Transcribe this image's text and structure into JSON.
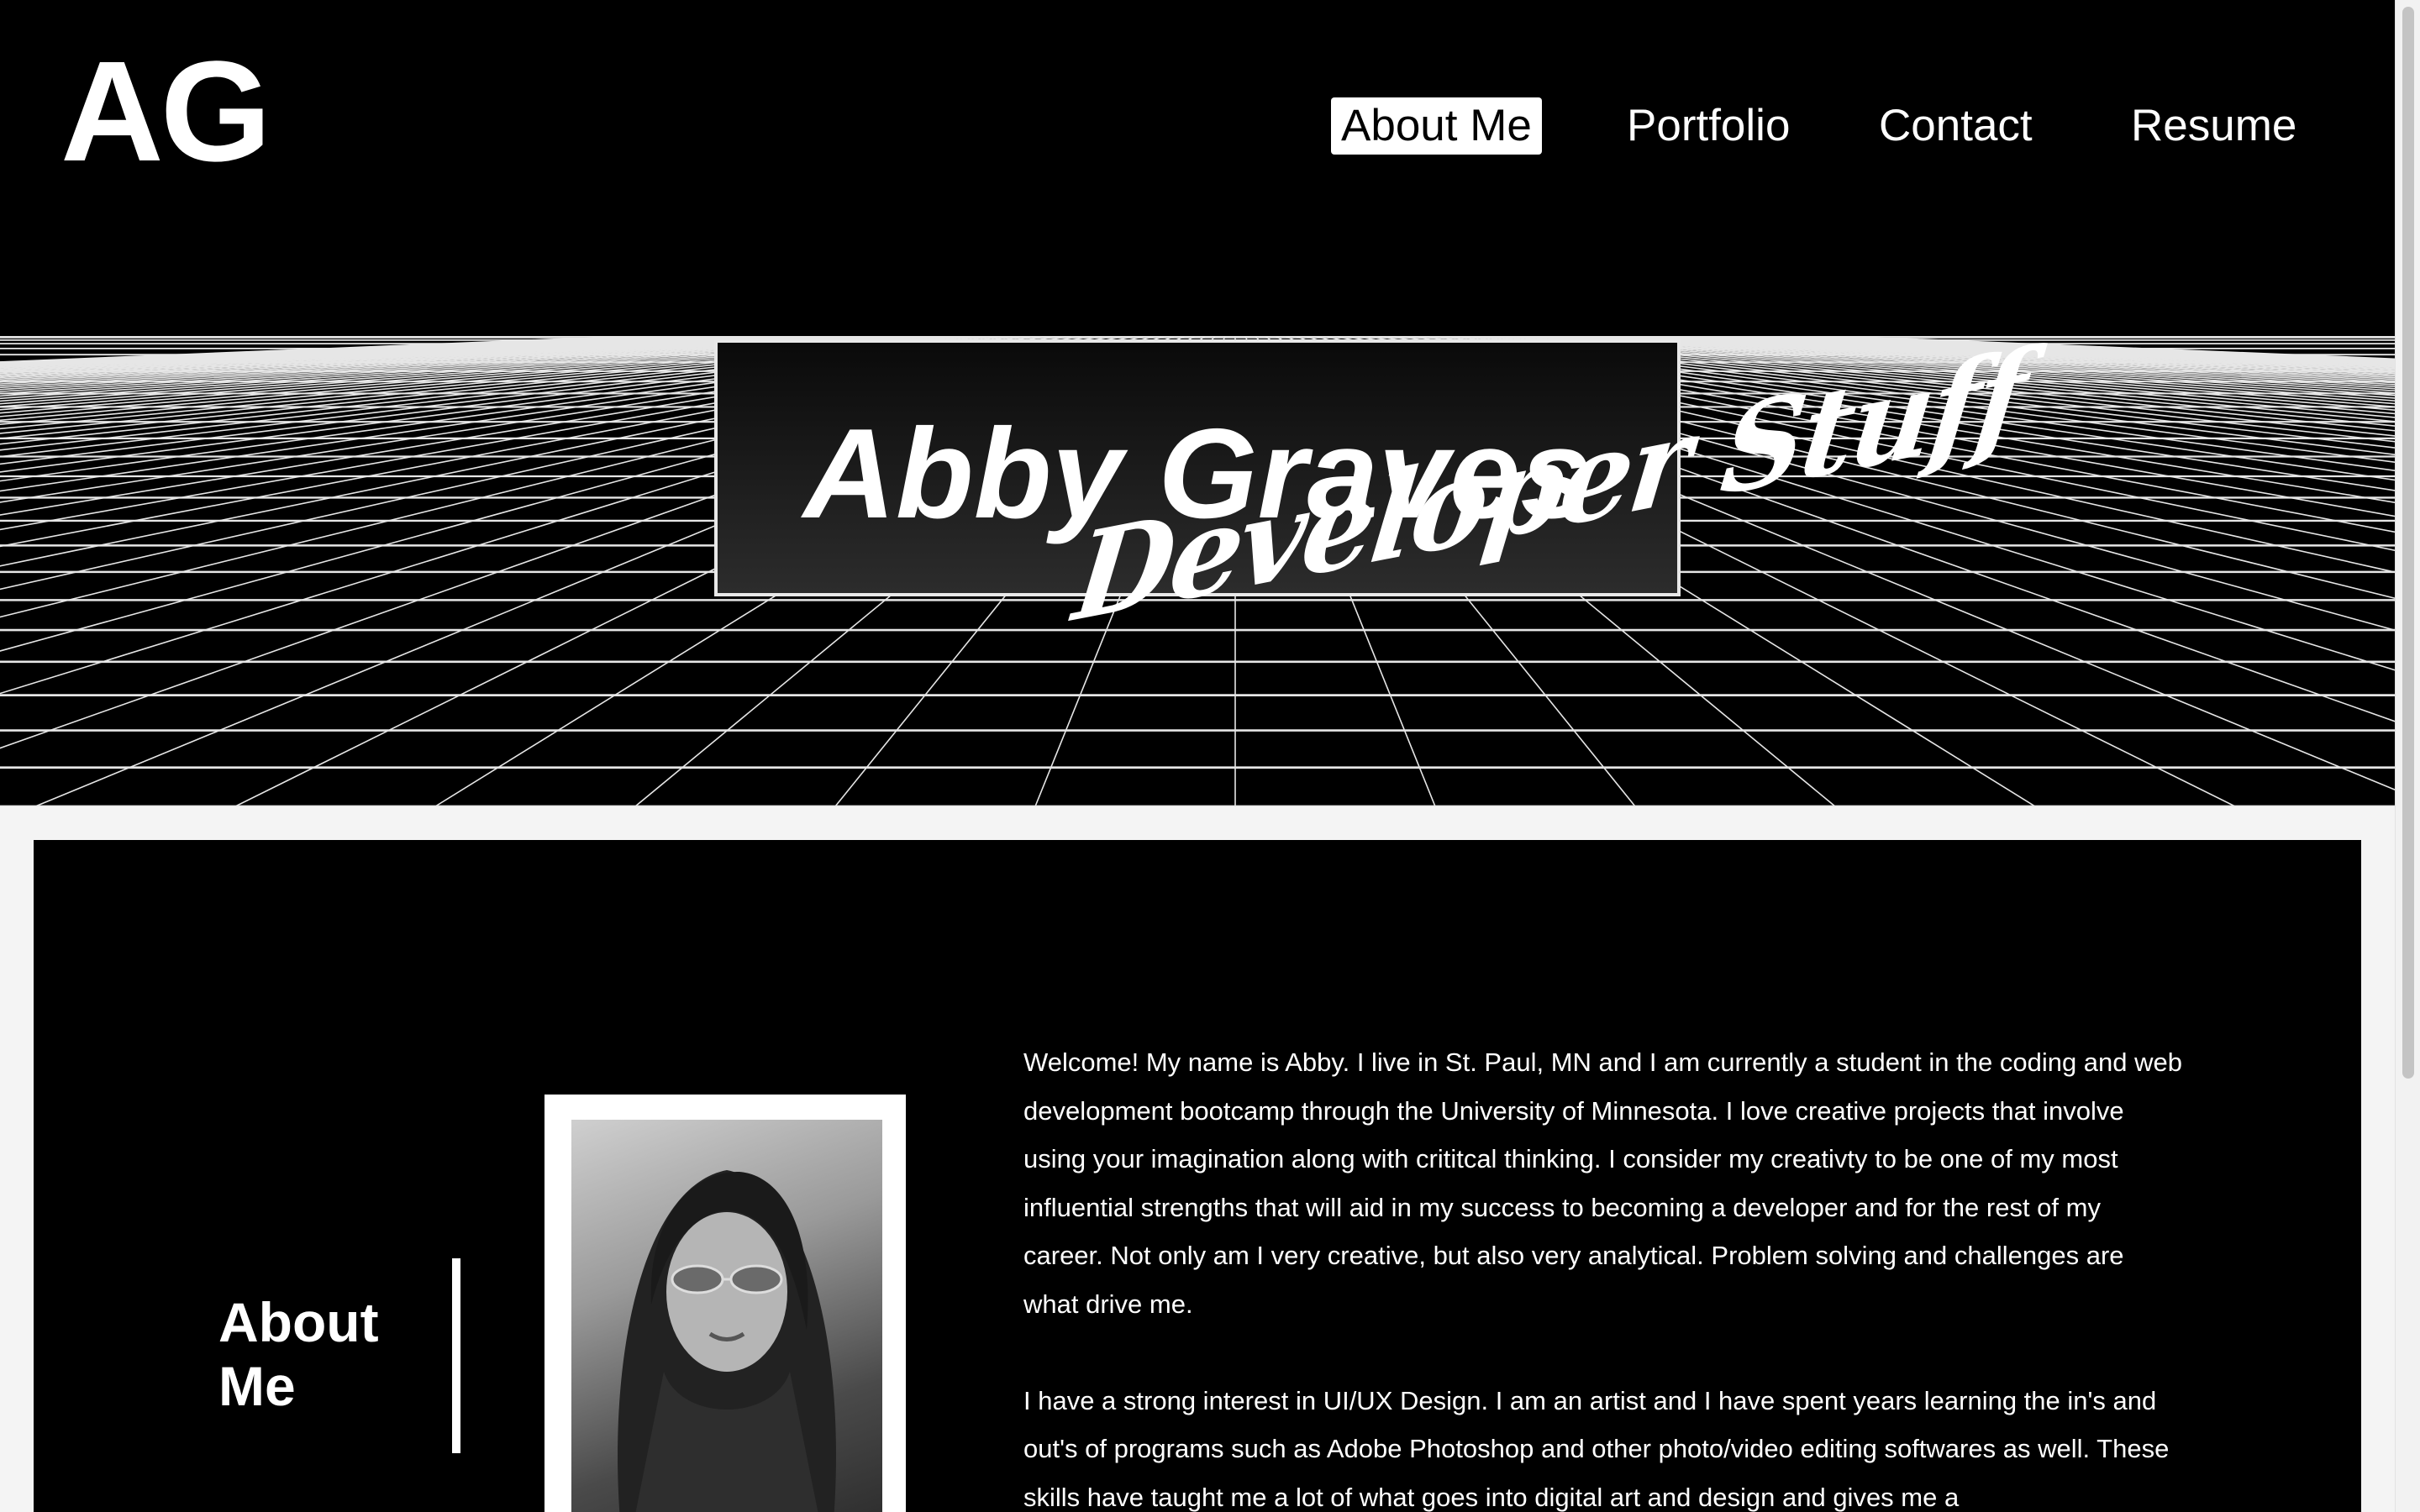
{
  "header": {
    "logo": "AG",
    "nav": [
      {
        "label": "About Me",
        "active": true
      },
      {
        "label": "Portfolio",
        "active": false
      },
      {
        "label": "Contact",
        "active": false
      },
      {
        "label": "Resume",
        "active": false
      }
    ]
  },
  "hero": {
    "name": "Abby Graves",
    "tagline": "Developer Stuff"
  },
  "about": {
    "heading": "About Me",
    "photo_icon": "portrait-photo",
    "paragraphs": [
      "Welcome! My name is Abby. I live in St. Paul, MN and I am currently a student in the coding and web development bootcamp through the University of Minnesota. I love creative projects that involve using your imagination along with crititcal thinking. I consider my creativty to be one of my most influential strengths that will aid in my success to becoming a developer and for the rest of my career. Not only am I very creative, but also very analytical. Problem solving and challenges are what drive me.",
      "I have a strong interest in UI/UX Design. I am an artist and I have spent years learning the in's and out's of programs such as Adobe Photoshop and other photo/video editing softwares as well. These skills have taught me a lot of what goes into digital art and design and gives me a"
    ]
  },
  "colors": {
    "background": "#000000",
    "text": "#ffffff",
    "page": "#f4f4f4",
    "active_nav_bg": "#ffffff"
  }
}
